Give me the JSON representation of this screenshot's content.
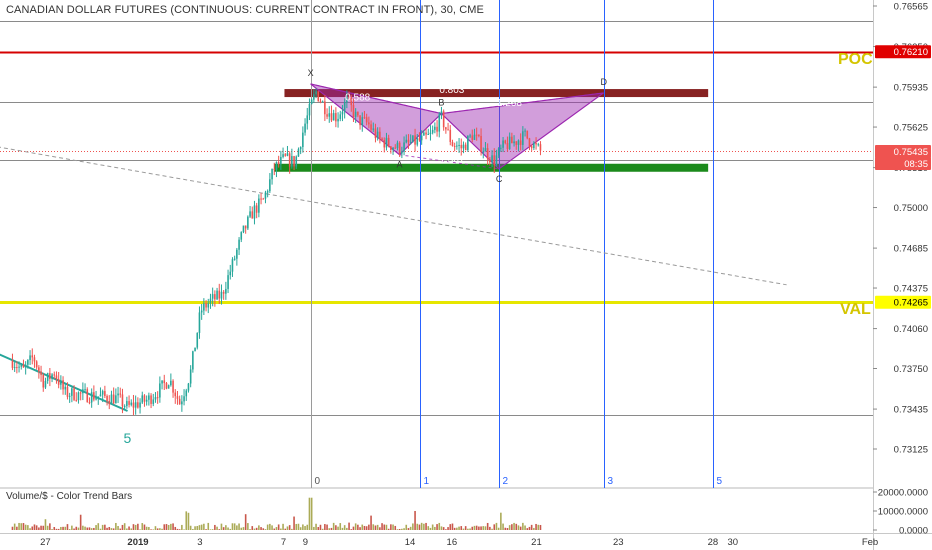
{
  "window": {
    "title": "CANADIAN DOLLAR FUTURES (CONTINUOUS: CURRENT CONTRACT IN FRONT), 30, CME",
    "volume_label": "Volume/$ - Color Trend Bars"
  },
  "colors": {
    "bull": "#26a69a",
    "bear": "#ef5350",
    "pattern": "#9c27b0",
    "poc": "#d50000",
    "val": "#e6e600",
    "level_text": "#d4c500",
    "green_zone": "#1b8a1b",
    "red_zone": "#7a0a0a",
    "cycle_line": "#2962ff"
  },
  "levels": {
    "poc": {
      "label": "POC",
      "price": 0.7621,
      "badge": "0.76210"
    },
    "val": {
      "label": "VAL",
      "price": 0.74265,
      "badge": "0.74265"
    },
    "current": {
      "price": 0.75435,
      "badge": "0.75435",
      "countdown": "08:35"
    },
    "partial_badge": "0.75375"
  },
  "chart_data": {
    "type": "candlestick",
    "title": "CANADIAN DOLLAR FUTURES (CONTINUOUS: CURRENT CONTRACT IN FRONT), 30, CME",
    "interval": "30",
    "price_ticks": [
      "0.76565",
      "0.76250",
      "0.75935",
      "0.75625",
      "0.75310",
      "0.75000",
      "0.74685",
      "0.74375",
      "0.74060",
      "0.73750",
      "0.73435",
      "0.73125"
    ],
    "time_ticks": [
      "27",
      "2019",
      "3",
      "7",
      "9",
      "14",
      "16",
      "21",
      "23",
      "28",
      "30",
      "Feb"
    ],
    "volume_ticks": [
      "20000.0000",
      "10000.0000",
      "0.0000"
    ],
    "price_path": [
      [
        "2018-12-26 00:00",
        0.7381
      ],
      [
        "2018-12-26 12:00",
        0.7373
      ],
      [
        "2018-12-27 00:00",
        0.7384
      ],
      [
        "2018-12-27 12:00",
        0.7364
      ],
      [
        "2018-12-28 00:00",
        0.7372
      ],
      [
        "2018-12-28 12:00",
        0.7356
      ],
      [
        "2018-12-31 00:00",
        0.7352
      ],
      [
        "2018-12-31 12:00",
        0.7345
      ],
      [
        "2019-01-01 00:00",
        0.7348
      ],
      [
        "2019-01-01 12:00",
        0.7351
      ],
      [
        "2019-01-02 00:00",
        0.7358
      ],
      [
        "2019-01-02 12:00",
        0.7367
      ],
      [
        "2019-01-03 00:00",
        0.7348
      ],
      [
        "2019-01-03 12:00",
        0.7371
      ],
      [
        "2019-01-04 00:00",
        0.742
      ],
      [
        "2019-01-04 12:00",
        0.7428
      ],
      [
        "2019-01-05 00:00",
        0.7432
      ],
      [
        "2019-01-05 12:00",
        0.7455
      ],
      [
        "2019-01-06 00:00",
        0.748
      ],
      [
        "2019-01-06 12:00",
        0.7497
      ],
      [
        "2019-01-07 00:00",
        0.7506
      ],
      [
        "2019-01-07 12:00",
        0.753
      ],
      [
        "2019-01-08 00:00",
        0.7538
      ],
      [
        "2019-01-08 12:00",
        0.7535
      ],
      [
        "2019-01-09 00:00",
        0.7566
      ],
      [
        "2019-01-09 12:00",
        0.759
      ],
      [
        "2019-01-10 00:00",
        0.7576
      ],
      [
        "2019-01-10 12:00",
        0.757
      ],
      [
        "2019-01-11 00:00",
        0.7583
      ],
      [
        "2019-01-11 12:00",
        0.7568
      ],
      [
        "2019-01-12 00:00",
        0.7565
      ],
      [
        "2019-01-12 12:00",
        0.7553
      ],
      [
        "2019-01-13 00:00",
        0.7549
      ],
      [
        "2019-01-13 12:00",
        0.7546
      ],
      [
        "2019-01-14 00:00",
        0.755
      ],
      [
        "2019-01-14 12:00",
        0.7552
      ],
      [
        "2019-01-15 00:00",
        0.7556
      ],
      [
        "2019-01-15 12:00",
        0.757
      ],
      [
        "2019-01-16 00:00",
        0.755
      ],
      [
        "2019-01-16 12:00",
        0.7546
      ],
      [
        "2019-01-17 00:00",
        0.7557
      ],
      [
        "2019-01-17 12:00",
        0.7546
      ],
      [
        "2019-01-18 00:00",
        0.7536
      ],
      [
        "2019-01-18 12:00",
        0.7548
      ],
      [
        "2019-01-19 00:00",
        0.7551
      ],
      [
        "2019-01-19 12:00",
        0.7556
      ],
      [
        "2019-01-20 00:00",
        0.7547
      ],
      [
        "2019-01-20 06:00",
        0.75435
      ]
    ],
    "harmonic_pattern": {
      "points": [
        {
          "label": "X",
          "date": "2019-01-09 06:00",
          "price": 0.7596
        },
        {
          "label": "A",
          "date": "2019-01-13 12:00",
          "price": 0.7541
        },
        {
          "label": "B",
          "date": "2019-01-15 12:00",
          "price": 0.7573
        },
        {
          "label": "C",
          "date": "2019-01-18 06:00",
          "price": 0.753
        },
        {
          "label": "D",
          "date": "2019-01-23 06:00",
          "price": 0.7589
        }
      ],
      "ratios": [
        {
          "label": "0.588",
          "date": "2019-01-11 12:00",
          "price": 0.7583
        },
        {
          "label": "0.803",
          "date": "2019-01-16 00:00",
          "price": 0.7589
        },
        {
          "label": "1.268",
          "date": "2019-01-18 18:00",
          "price": 0.7579
        },
        {
          "label": "1.361",
          "date": "2019-01-16 00:00",
          "price": 0.7535
        }
      ]
    },
    "zones": [
      {
        "name": "red",
        "from": "2019-01-08 00:00",
        "to": "2019-01-28 06:00",
        "top": 0.7592,
        "bottom": 0.7586
      },
      {
        "name": "green",
        "from": "2019-01-07 12:00",
        "to": "2019-01-28 06:00",
        "top": 0.7534,
        "bottom": 0.7528
      }
    ],
    "horizontal_lines": [
      0.7645,
      0.7582,
      0.7537,
      0.7339
    ],
    "trend_line_dashed": {
      "from": [
        "2018-12-19 00:00",
        0.7565
      ],
      "to": [
        "2019-02-01 00:00",
        0.744
      ]
    },
    "trend_line_solid": {
      "from": [
        "2018-12-23 00:00",
        0.7403
      ],
      "to": [
        "2018-12-31 12:00",
        0.7342
      ]
    },
    "wave_label": {
      "text": "5",
      "date": "2018-12-31 12:00",
      "price": 0.7328
    },
    "cycle_lines": [
      {
        "label": "0",
        "date": "2019-01-09 06:00"
      },
      {
        "label": "1",
        "date": "2019-01-14 12:00"
      },
      {
        "label": "2",
        "date": "2019-01-18 06:00"
      },
      {
        "label": "3",
        "date": "2019-01-23 06:00"
      },
      {
        "label": "5",
        "date": "2019-01-28 12:00"
      }
    ]
  }
}
